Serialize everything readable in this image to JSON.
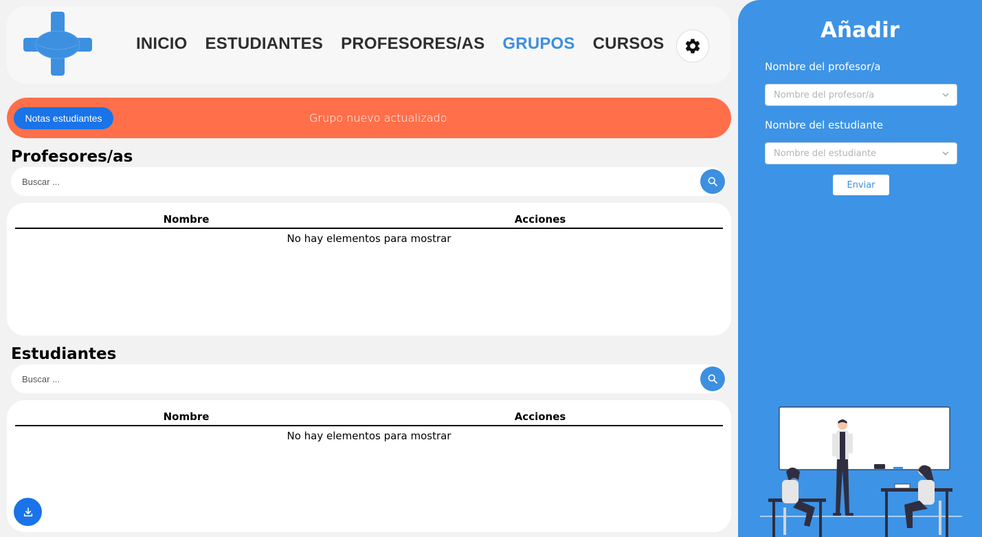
{
  "nav": {
    "items": [
      {
        "label": "INICIO",
        "active": false
      },
      {
        "label": "ESTUDIANTES",
        "active": false
      },
      {
        "label": "PROFESORES/AS",
        "active": false
      },
      {
        "label": "GRUPOS",
        "active": true
      },
      {
        "label": "CURSOS",
        "active": false
      }
    ],
    "settings_icon": "gear-icon"
  },
  "alert": {
    "button_label": "Notas estudiantes",
    "message": "Grupo nuevo actualizado",
    "color": "#ff6f4a"
  },
  "profesores": {
    "title": "Profesores/as",
    "search_placeholder": "Buscar ...",
    "columns": [
      "Nombre",
      "Acciones"
    ],
    "empty_text": "No hay elementos para mostrar"
  },
  "estudiantes": {
    "title": "Estudiantes",
    "search_placeholder": "Buscar ...",
    "columns": [
      "Nombre",
      "Acciones"
    ],
    "empty_text": "No hay elementos para mostrar"
  },
  "side": {
    "title": "Añadir",
    "profesor_label": "Nombre del profesor/a",
    "profesor_placeholder": "Nombre del profesor/a",
    "estudiante_label": "Nombre del estudiante",
    "estudiante_placeholder": "Nombre del estudiante",
    "submit_label": "Enviar"
  },
  "colors": {
    "accent": "#3d8fe0",
    "primary_button": "#1a73e8",
    "sidebar": "#3d93e6"
  },
  "icons": {
    "search": "search-icon",
    "download": "download-icon",
    "chevron": "chevron-down-icon"
  }
}
